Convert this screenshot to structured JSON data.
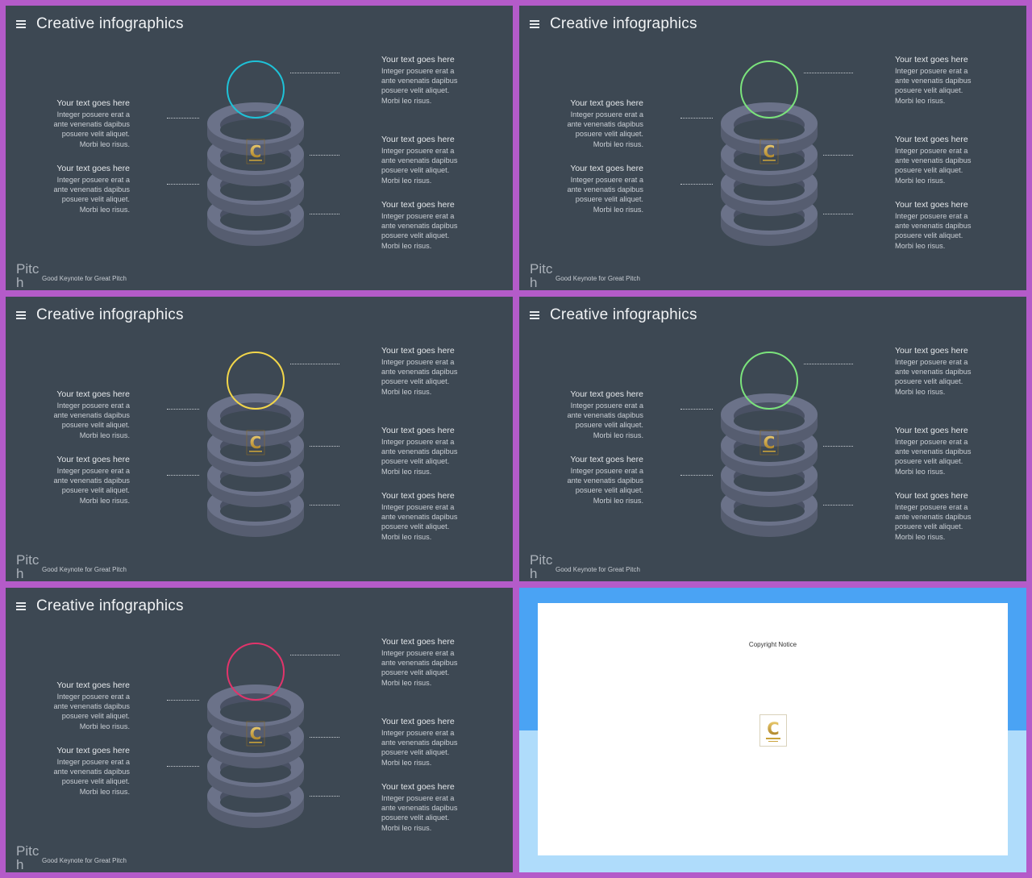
{
  "slides": [
    {
      "title": "Creative infographics",
      "accent": "#1ec2d8"
    },
    {
      "title": "Creative infographics",
      "accent": "#7be37c"
    },
    {
      "title": "Creative infographics",
      "accent": "#f2d64a"
    },
    {
      "title": "Creative infographics",
      "accent": "#7be37c"
    },
    {
      "title": "Creative infographics",
      "accent": "#e2346b"
    }
  ],
  "text_blocks": {
    "title": "Your text goes here",
    "body_lines": [
      "Integer posuere erat a",
      "ante venenatis dapibus",
      "posuere velit aliquet.",
      "Morbi leo risus."
    ]
  },
  "brand": {
    "name": "Pitch",
    "tagline": "Good Keynote for Great Pitch"
  },
  "logo_letter": "C",
  "copyright": {
    "title": "Copyright Notice"
  },
  "colors": {
    "purple_frame": "#b45bc9",
    "slide_bg": "#3d4853",
    "ring": "#6b7289",
    "logo_gold": "#c9a23a"
  }
}
